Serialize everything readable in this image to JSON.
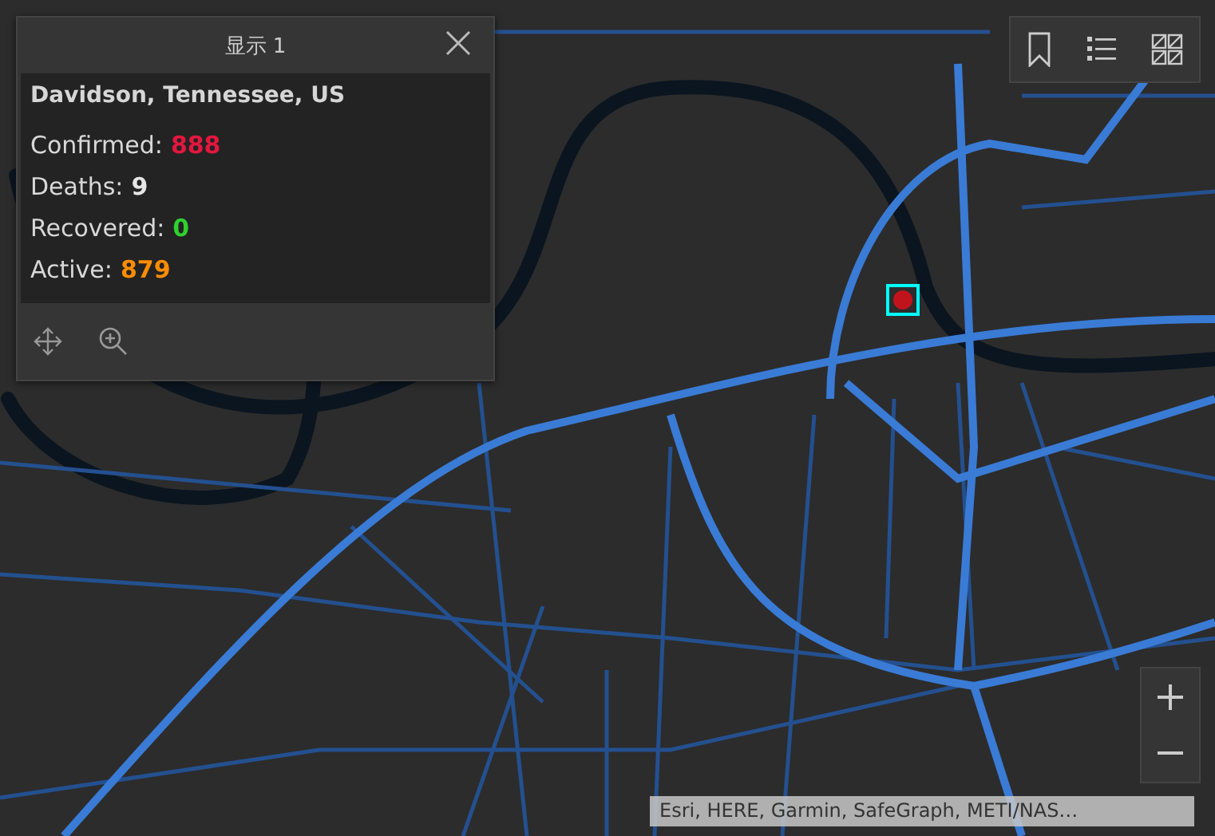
{
  "popup": {
    "title": "显示 1",
    "heading": "Davidson, Tennessee, US",
    "fields": [
      {
        "label": "Confirmed:",
        "value": "888",
        "color": "#e3173e"
      },
      {
        "label": "Deaths:",
        "value": "9",
        "color": "#e6e6e6"
      },
      {
        "label": "Recovered:",
        "value": "0",
        "color": "#2fd12f"
      },
      {
        "label": "Active:",
        "value": "879",
        "color": "#ff8c00"
      }
    ]
  },
  "attribution": "Esri, HERE, Garmin, SafeGraph, METI/NAS…"
}
